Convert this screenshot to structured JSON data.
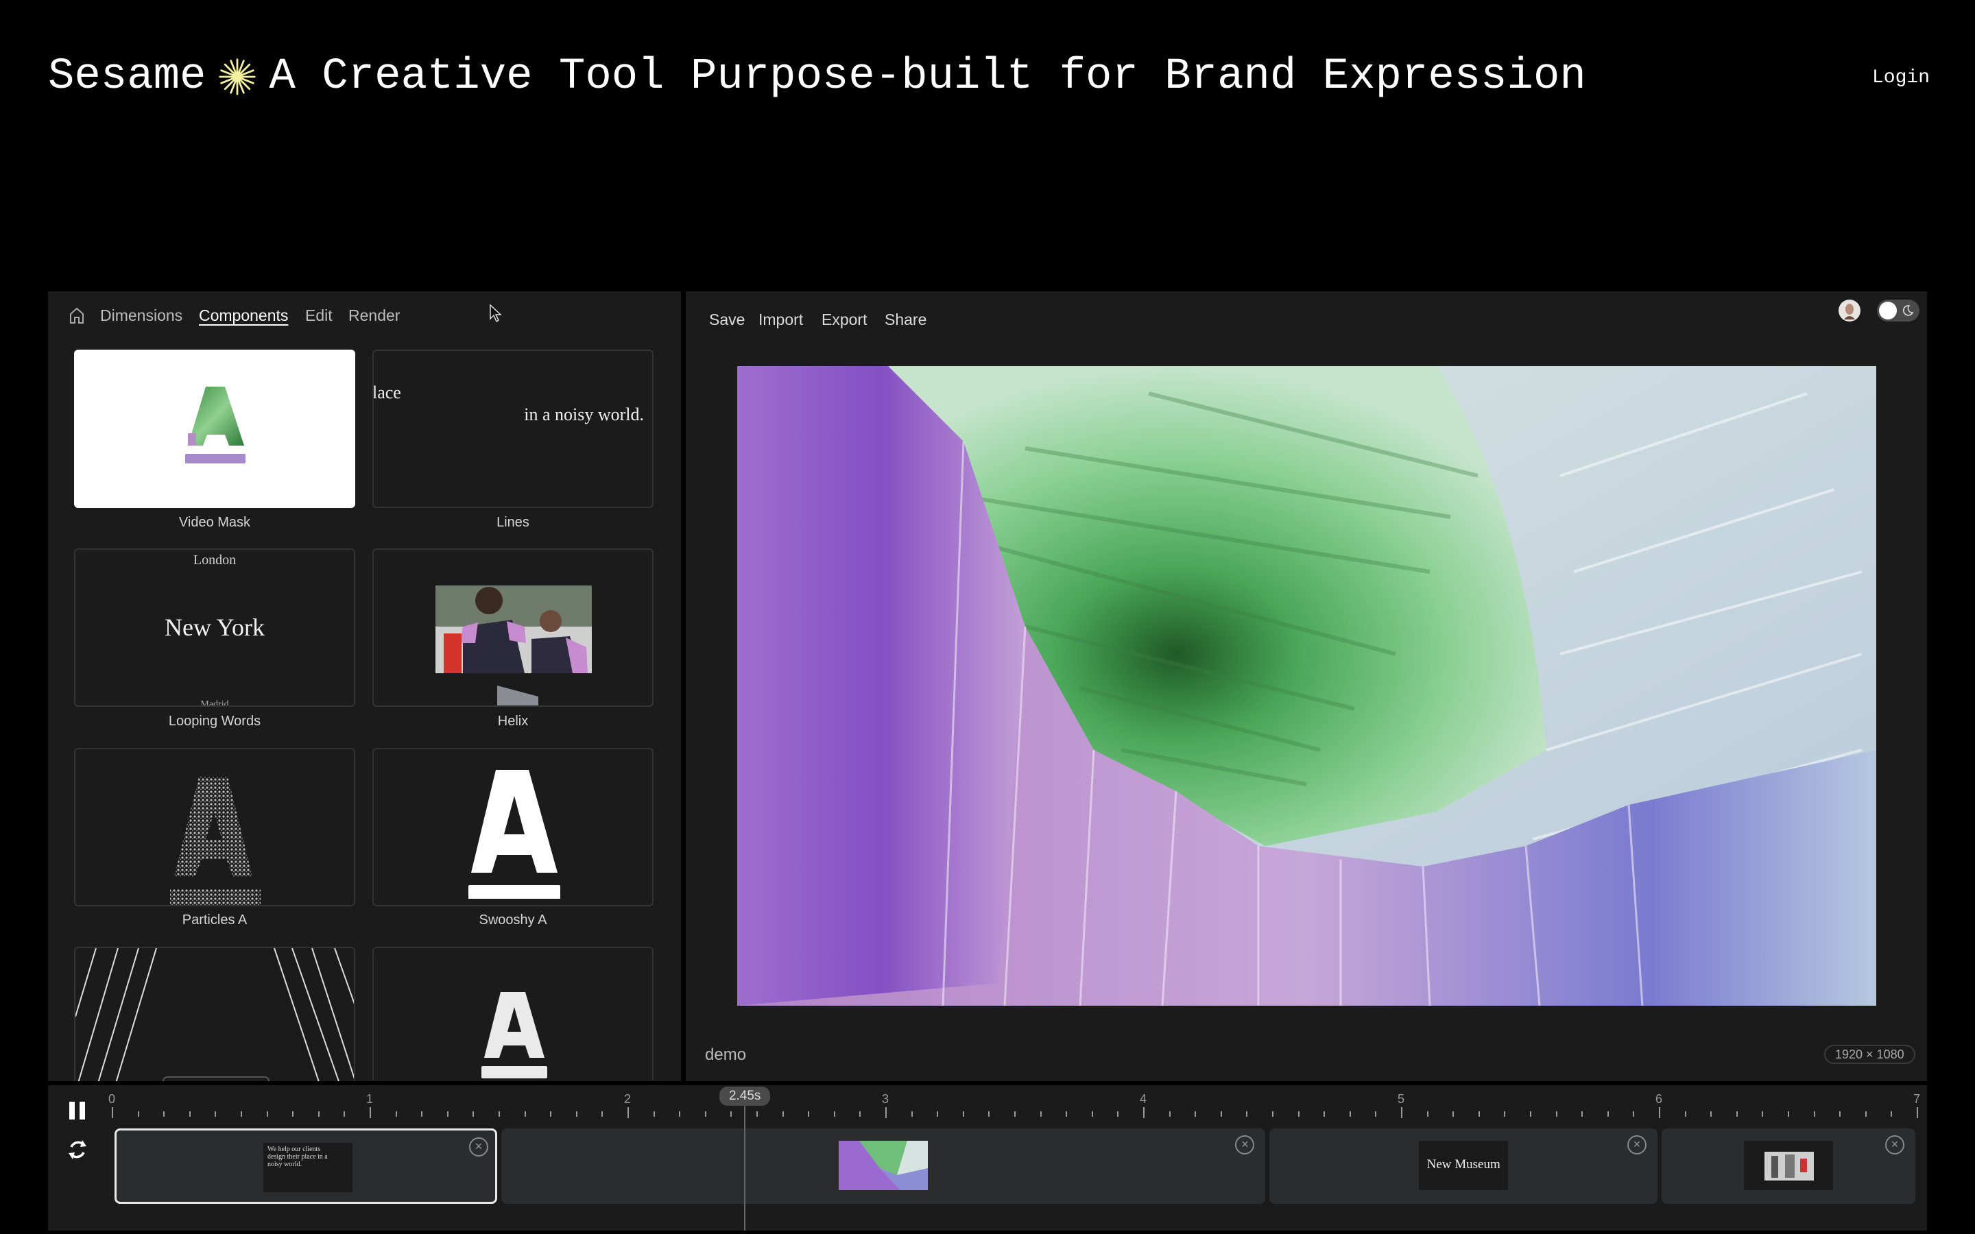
{
  "header": {
    "brand": "Sesame",
    "star_icon": "asterisk-star-icon",
    "star_color": "#f3f0a0",
    "tagline": "A Creative Tool Purpose-built for Brand Expression",
    "login": "Login"
  },
  "left_nav": {
    "items": [
      {
        "label": "Dimensions"
      },
      {
        "label": "Components",
        "active": true
      },
      {
        "label": "Edit"
      },
      {
        "label": "Render"
      }
    ]
  },
  "components": [
    {
      "label": "Video Mask"
    },
    {
      "label": "Lines",
      "preview_text_1": "lace",
      "preview_text_2": "in a noisy world."
    },
    {
      "label": "Looping Words",
      "preview_text": "New York",
      "preview_top": "London",
      "preview_bottom": "Madrid"
    },
    {
      "label": "Helix"
    },
    {
      "label": "Particles A"
    },
    {
      "label": "Swooshy A"
    },
    {
      "label": ""
    },
    {
      "label": ""
    }
  ],
  "toolbar": {
    "save": "Save",
    "import": "Import",
    "export": "Export",
    "share": "Share"
  },
  "canvas": {
    "name": "demo",
    "dimensions": "1920 × 1080",
    "theme": "light"
  },
  "timeline": {
    "playhead": "2.45s",
    "playhead_seconds": 2.45,
    "ticks": [
      "0",
      "1",
      "2",
      "3",
      "4",
      "5",
      "6",
      "7"
    ],
    "clips": [
      {
        "thumb_text": "We help our clients design their place in a noisy world.",
        "start": 0,
        "end": 1.5,
        "selected": true
      },
      {
        "thumb_text": "",
        "start": 1.5,
        "end": 4.48
      },
      {
        "thumb_text": "New Museum",
        "start": 4.48,
        "end": 6.0
      },
      {
        "thumb_text": "",
        "start": 6.0,
        "end": 7.0
      }
    ]
  }
}
